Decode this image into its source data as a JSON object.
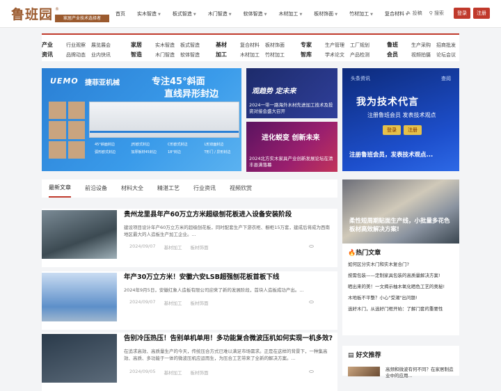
{
  "logo": {
    "text": "鲁班园",
    "tagline": "家居产业技术选择者",
    "reg": "®"
  },
  "nav": [
    {
      "label": "首页",
      "dropdown": false
    },
    {
      "label": "实木智造",
      "dropdown": true
    },
    {
      "label": "板式智造",
      "dropdown": true
    },
    {
      "label": "木门智造",
      "dropdown": true
    },
    {
      "label": "软体智造",
      "dropdown": true
    },
    {
      "label": "木材加工",
      "dropdown": true
    },
    {
      "label": "板材饰面",
      "dropdown": true
    },
    {
      "label": "竹材加工",
      "dropdown": true
    },
    {
      "label": "复合材料",
      "dropdown": true
    }
  ],
  "top_right": {
    "post": "投稿",
    "search": "搜索",
    "login": "登录",
    "register": "注册"
  },
  "categories": [
    {
      "title": "产业资讯",
      "links": [
        "行业观察",
        "展览展会",
        "品牌动态",
        "业内快讯"
      ]
    },
    {
      "title": "家居智造",
      "links": [
        "实木智造",
        "板式智造",
        "木门智造",
        "软体智造"
      ]
    },
    {
      "title": "基材加工",
      "links": [
        "复合材料",
        "板材饰面",
        "木材加工",
        "竹材加工"
      ]
    },
    {
      "title": "专家智库",
      "links": [
        "生产管理",
        "工厂规划",
        "学术论文",
        "产品检测"
      ]
    },
    {
      "title": "鲁班会员",
      "links": [
        "生产采购",
        "招商批发",
        "视频拍摄",
        "论坛会议"
      ]
    }
  ],
  "banner_main": {
    "brand": "UEMO",
    "brand_cn": "捷菲亚机械",
    "title1": "专注45°斜面",
    "title2": "直线异形封边",
    "tags": [
      "45°斜面封边",
      "J形欧式封边",
      "C形欧式封边",
      "L形双面封边",
      "弧形欧式封边",
      "加厚板材45封边",
      "18°封边",
      "T形门 / 异形封边"
    ]
  },
  "banner_small_1": {
    "headline": "观趋势 定未来",
    "caption": "2024一带一路海外木材先进加工技术及投资对接会盛大召开"
  },
  "banner_small_2": {
    "headline": "进化蜕变 创新未来",
    "caption": "2024北方实木家具产业创新发展论坛在清丰县满落幕"
  },
  "banner_right": {
    "label": "头条资讯",
    "more": "查阅",
    "headline": "我为技术代言",
    "sub": "注册鲁班会员 发表技术观点",
    "btn_login": "登录",
    "btn_register": "注册",
    "caption": "注册鲁班会员，发表技术观点..."
  },
  "tabs": [
    "最新文章",
    "前沿设备",
    "材料大全",
    "精湛工艺",
    "行业资讯",
    "视频欣赏"
  ],
  "articles": [
    {
      "title": "贵州龙里县年产60万立方米超级刨花板进入设备安装阶段",
      "summary": "建设项目设计年产60万立方米的超级刨花板，同时配套生产下游衣柜、橱柜15万套，建成后将成为西南地区最大的人造板生产加工企业。...",
      "date": "2024/09/07",
      "cat1": "基材加工",
      "cat2": "板材饰面"
    },
    {
      "title": "年产30万立方米！安徽六安LSB超强刨花板首板下线",
      "summary": "2024年9月5日，安徽红象人造板有限公司迎来了新的发展阶段，首块人造板成功产出。...",
      "date": "2024/09/07",
      "cat1": "基材加工",
      "cat2": "板材饰面"
    },
    {
      "title": "告别冷压热压！告别单机单用！多功能复合微波压机如何实现一机多效?",
      "summary": "在追求高效、高质量生产的今天，传统压合方式已难以满足市场需求。正是在这样的背景下，一种集高效、高质、多功能于一体的微波压机应运而生，为压合工艺带来了全新的解决方案。...",
      "date": "2024/09/05",
      "cat1": "基材加工",
      "cat2": "板材饰面"
    }
  ],
  "feature": {
    "title": "柔性短周期贴面生产线，小批量多花色板材高效解决方案!"
  },
  "hot": {
    "heading": "热门文章",
    "items": [
      "如何区分实木门和实木复合门?",
      "按需包装——定制家具包装的高质量解决方案!",
      "晒出来的美！一文揭示柚木氧化晒色工艺的奥秘!",
      "木地板不平整？小心\"受潮\"出问题!",
      "选好木门，从选好门框开始：了解门套的重要性"
    ]
  },
  "recommend": {
    "heading": "好文推荐",
    "item": "高频和微波有何不同？在家居制造业中的应用..."
  }
}
